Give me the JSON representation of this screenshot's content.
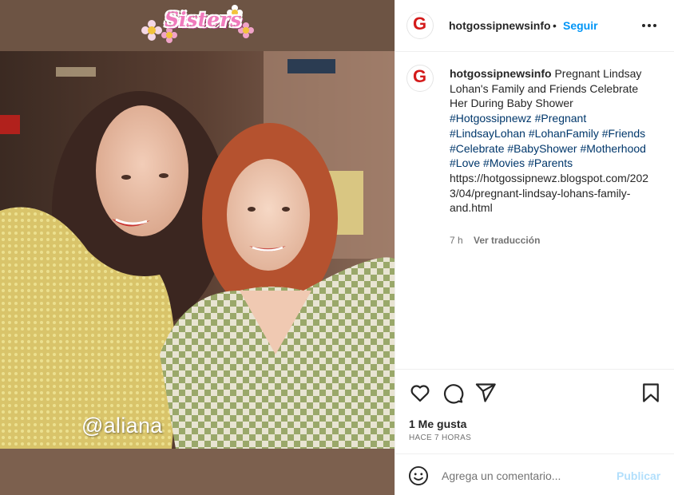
{
  "post": {
    "sticker_text": "Sisters",
    "watermark": "@aliana"
  },
  "header": {
    "username": "hotgossipnewsinfo",
    "separator": "•",
    "follow_label": "Seguir",
    "more_icon": "more-horizontal-icon"
  },
  "caption": {
    "username": "hotgossipnewsinfo",
    "text": "Pregnant Lindsay Lohan's Family and Friends Celebrate Her During Baby Shower",
    "hashtags": [
      "#Hotgossipnewz",
      "#Pregnant",
      "#LindsayLohan",
      "#LohanFamily",
      "#Friends",
      "#Celebrate",
      "#BabyShower",
      "#Motherhood",
      "#Love",
      "#Movies",
      "#Parents"
    ],
    "link": "https://hotgossipnewz.blogspot.com/2023/04/pregnant-lindsay-lohans-family-and.html",
    "age": "7 h",
    "translate_label": "Ver traducción"
  },
  "actions": {
    "likes": "1 Me gusta",
    "time": "HACE 7 HORAS"
  },
  "comment": {
    "placeholder": "Agrega un comentario...",
    "publish_label": "Publicar"
  },
  "colors": {
    "accent": "#0095f6",
    "publish_disabled": "#b2dffc",
    "hashtag": "#00376b",
    "brand_red": "#d41b1b"
  }
}
